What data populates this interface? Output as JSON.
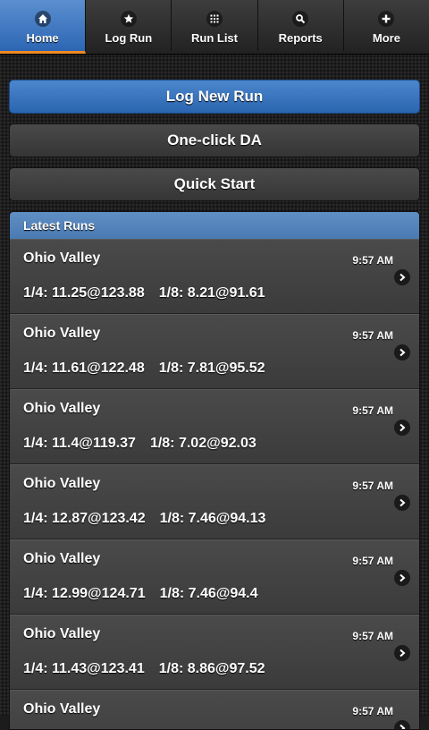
{
  "nav": {
    "tabs": [
      {
        "label": "Home",
        "icon": "home-icon",
        "active": true
      },
      {
        "label": "Log Run",
        "icon": "star-icon",
        "active": false
      },
      {
        "label": "Run List",
        "icon": "grid-icon",
        "active": false
      },
      {
        "label": "Reports",
        "icon": "search-icon",
        "active": false
      },
      {
        "label": "More",
        "icon": "plus-icon",
        "active": false
      }
    ]
  },
  "actions": {
    "log_new_run": "Log New Run",
    "one_click_da": "One-click DA",
    "quick_start": "Quick Start"
  },
  "latest_runs": {
    "title": "Latest Runs",
    "items": [
      {
        "track": "Ohio Valley",
        "time": "9:57 AM",
        "quarter": "1/4: 11.25@123.88",
        "eighth": "1/8: 8.21@91.61"
      },
      {
        "track": "Ohio Valley",
        "time": "9:57 AM",
        "quarter": "1/4: 11.61@122.48",
        "eighth": "1/8: 7.81@95.52"
      },
      {
        "track": "Ohio Valley",
        "time": "9:57 AM",
        "quarter": "1/4: 11.4@119.37",
        "eighth": "1/8: 7.02@92.03"
      },
      {
        "track": "Ohio Valley",
        "time": "9:57 AM",
        "quarter": "1/4: 12.87@123.42",
        "eighth": "1/8: 7.46@94.13"
      },
      {
        "track": "Ohio Valley",
        "time": "9:57 AM",
        "quarter": "1/4: 12.99@124.71",
        "eighth": "1/8: 7.46@94.4"
      },
      {
        "track": "Ohio Valley",
        "time": "9:57 AM",
        "quarter": "1/4: 11.43@123.41",
        "eighth": "1/8: 8.86@97.52"
      },
      {
        "track": "Ohio Valley",
        "time": "9:57 AM",
        "quarter": "",
        "eighth": ""
      }
    ]
  },
  "colors": {
    "accent_blue": "#2c66b3",
    "active_tab_underline": "#f08a24",
    "list_header": "#5a89bf"
  }
}
